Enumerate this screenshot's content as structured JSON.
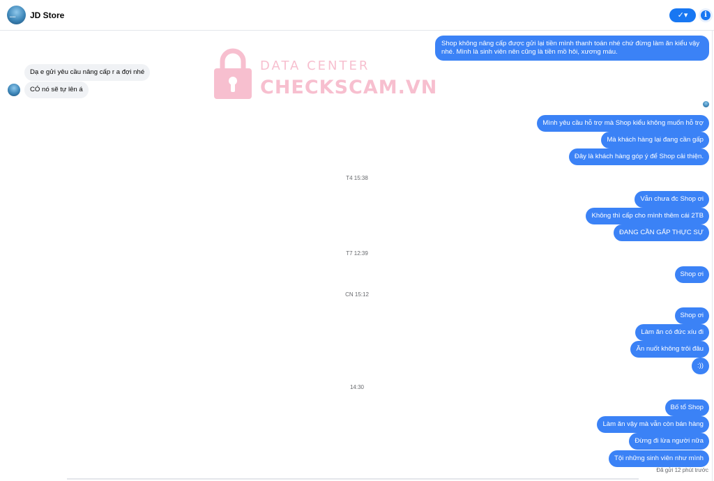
{
  "header": {
    "title": "JD Store",
    "check_label": "✓▾",
    "info_label": "i"
  },
  "watermark": {
    "line1": "DATA CENTER",
    "line2": "CHECKSCAM.VN"
  },
  "messages": {
    "m1_l1": "Shop không nâng cấp được gửi lại tiền mình thanh toán nhé chứ đừng làm ăn kiểu vậy",
    "m1_l2": "nhé. Mình là sinh viên nên cũng là tiền mồ hôi, xương máu.",
    "in1": "Dạ e gửi yêu cầu nâng cấp r a đợi nhé",
    "in2": "CÓ nó sẽ tự lên á",
    "m2": "Mình yêu cầu hỗ trợ mà Shop kiểu không muốn hỗ trợ",
    "m3": "Mà khách hàng lại đang cần gấp",
    "m4": "Đây là khách hàng góp ý để Shop cải thiện.",
    "m5": "Vẫn chưa đc Shop ơi",
    "m6": "Không thì cấp cho mình thêm cái 2TB",
    "m7": "ĐANG CẦN GẤP THỰC SỰ",
    "m8": "Shop ơi",
    "m9": "Shop ơi",
    "m10": "Làm ăn có đức xíu đi",
    "m11": "Ăn nuốt không trôi đâu",
    "m12": ":))",
    "m13": "Bố tổ Shop",
    "m14": "Làm ăn vậy mà vẫn còn bán hàng",
    "m15": "Đừng đi lừa người nữa",
    "m16": "Tội những sinh viên như mình"
  },
  "timestamps": {
    "t1": "T4 15:38",
    "t2": "T7 12:39",
    "t3": "CN 15:12",
    "t4": "14:30"
  },
  "status": "Đã gửi 12 phút trước",
  "colors": {
    "outgoing_bubble": "#3b82f6",
    "incoming_bubble": "#f0f2f5",
    "accent": "#1877f2"
  }
}
